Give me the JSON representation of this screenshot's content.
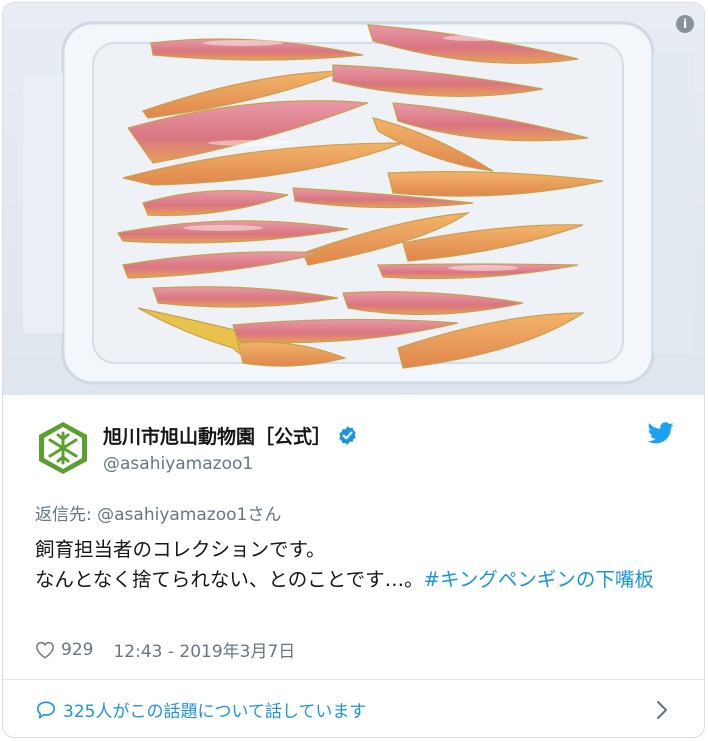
{
  "tweet": {
    "display_name": "旭川市旭山動物園［公式］",
    "handle": "@asahiyamazoo1",
    "reply_to": "返信先: @asahiyamazoo1さん",
    "text_line1": "飼育担当者のコレクションです。",
    "text_line2": "なんとなく捨てられない、とのことです…。",
    "hashtag": "#キングペンギンの下嘴板",
    "likes": "929",
    "timestamp": "12:43 - 2019年3月7日",
    "conversation": "325人がこの話題について話しています"
  },
  "icons": {
    "info": "info-icon",
    "verified": "verified-badge-icon",
    "brand": "twitter-bird-icon",
    "like": "heart-icon",
    "reply": "speech-bubble-icon",
    "more": "chevron-right-icon"
  },
  "colors": {
    "accent": "#1b95e0",
    "secondary_text": "#657786",
    "avatar_green": "#5aa02c"
  }
}
